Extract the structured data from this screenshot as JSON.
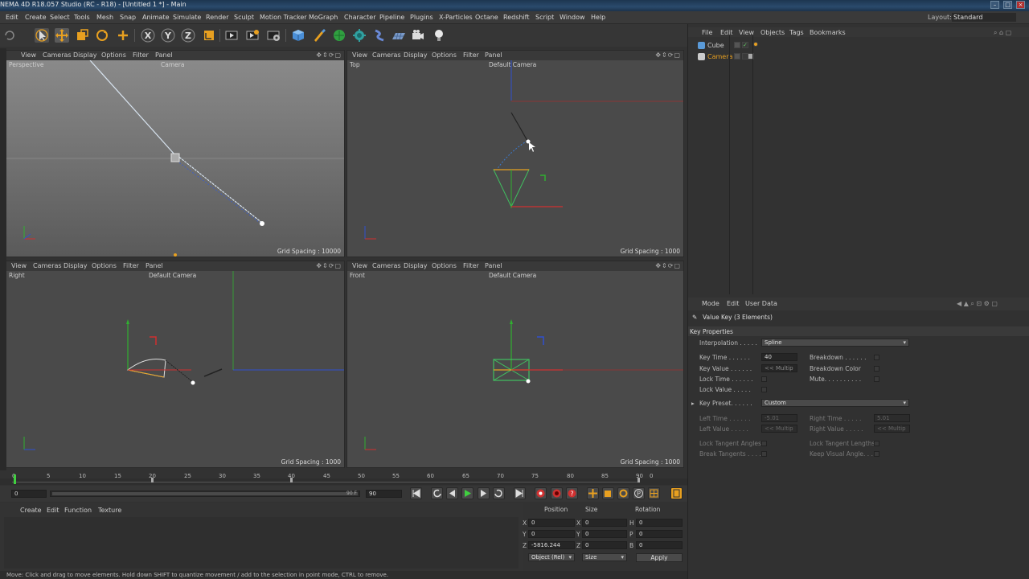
{
  "app": {
    "title": "NEMA 4D R18.057 Studio (RC - R18) - [Untitled 1 *] - Main"
  },
  "menubar": {
    "items": [
      "Edit",
      "Create",
      "Select",
      "Tools",
      "Mesh",
      "Snap",
      "Animate",
      "Simulate",
      "Render",
      "Sculpt",
      "Motion Tracker",
      "MoGraph",
      "Character",
      "Pipeline",
      "Plugins",
      "X-Particles",
      "Octane",
      "Redshift",
      "Script",
      "Window",
      "Help"
    ],
    "layout_label": "Layout:",
    "layout_value": "Standard"
  },
  "toolbar": {
    "icons": [
      "select-icon",
      "move-icon",
      "scale-icon",
      "rotate-icon",
      "add-icon",
      "x-axis-icon",
      "y-axis-icon",
      "z-axis-icon",
      "coord-system-icon",
      "render-view-icon",
      "render-picture-queue-icon",
      "render-settings-icon",
      "cube-icon",
      "pen-icon",
      "subdivision-icon",
      "array-icon",
      "deformer-icon",
      "floor-icon",
      "camera-icon",
      "light-icon"
    ]
  },
  "viewports": {
    "menu": [
      "View",
      "Cameras",
      "Display",
      "Options",
      "Filter",
      "Panel"
    ],
    "perspective": {
      "label": "Perspective",
      "camera": "Camera",
      "grid": "Grid Spacing : 10000"
    },
    "top": {
      "label": "Top",
      "camera": "Default Camera",
      "grid": "Grid Spacing : 1000"
    },
    "right": {
      "label": "Right",
      "camera": "Default Camera",
      "grid": "Grid Spacing : 1000"
    },
    "front": {
      "label": "Front",
      "camera": "Default Camera",
      "grid": "Grid Spacing : 1000"
    }
  },
  "object_manager": {
    "menu": [
      "File",
      "Edit",
      "View",
      "Objects",
      "Tags",
      "Bookmarks"
    ],
    "objects": [
      {
        "name": "Cube"
      },
      {
        "name": "Camera"
      }
    ]
  },
  "attributes": {
    "menu": [
      "Mode",
      "Edit",
      "User Data"
    ],
    "header": "Value Key (3 Elements)",
    "section": "Key Properties",
    "interpolation_label": "Interpolation . . . . .",
    "interpolation_value": "Spline",
    "key_time_label": "Key Time . . . . . .",
    "key_time_value": "40",
    "key_value_label": "Key Value . . . . . .",
    "key_value_value": "<< Multip",
    "lock_time_label": "Lock Time . . . . . .",
    "lock_value_label": "Lock Value . . . . .",
    "breakdown_label": "Breakdown . . . . . .",
    "breakdown_color_label": "Breakdown Color",
    "mute_label": "Mute. . . . . . . . . .",
    "key_preset_label": "Key Preset. . . . . .",
    "key_preset_value": "Custom",
    "left_time_label": "Left Time . . . . . .",
    "left_time_value": "-5.01",
    "right_time_label": "Right Time . . . . .",
    "right_time_value": "5.01",
    "left_value_label": "Left Value . . . . .",
    "left_value_value": "<< Multip",
    "right_value_label": "Right Value . . . . .",
    "right_value_value": "<< Multip",
    "lock_tangent_angles_label": "Lock Tangent Angles",
    "lock_tangent_lengths_label": "Lock Tangent Lengths",
    "break_tangents_label": "Break Tangents . . . .",
    "keep_visual_angle_label": "Keep Visual Angle. . ."
  },
  "timeline": {
    "ticks": [
      "0",
      "5",
      "10",
      "15",
      "20",
      "25",
      "30",
      "35",
      "40",
      "45",
      "50",
      "55",
      "60",
      "65",
      "70",
      "75",
      "80",
      "85",
      "90"
    ],
    "current_frame": "0",
    "start_field": "0",
    "end_field": "90",
    "end_inner": "90 F",
    "frame_field": "90",
    "end_tick": "0"
  },
  "material_manager": {
    "menu": [
      "Create",
      "Edit",
      "Function",
      "Texture"
    ]
  },
  "coordinates": {
    "headers": [
      "Position",
      "Size",
      "Rotation"
    ],
    "rows": [
      {
        "axis": "X",
        "pos": "0",
        "saxis": "X",
        "size": "0",
        "raxis": "H",
        "rot": "0"
      },
      {
        "axis": "Y",
        "pos": "0",
        "saxis": "Y",
        "size": "0",
        "raxis": "P",
        "rot": "0"
      },
      {
        "axis": "Z",
        "pos": "-5816.244",
        "saxis": "Z",
        "size": "0",
        "raxis": "B",
        "rot": "0"
      }
    ],
    "mode_value": "Object (Rel)",
    "size_mode_value": "Size",
    "apply_label": "Apply"
  },
  "status": {
    "text": "Move: Click and drag to move elements. Hold down SHIFT to quantize movement / add to the selection in point mode, CTRL to remove."
  },
  "colors": {
    "x_axis": "#d03030",
    "y_axis": "#30b030",
    "z_axis": "#3050d0",
    "accent": "#e8a020"
  }
}
